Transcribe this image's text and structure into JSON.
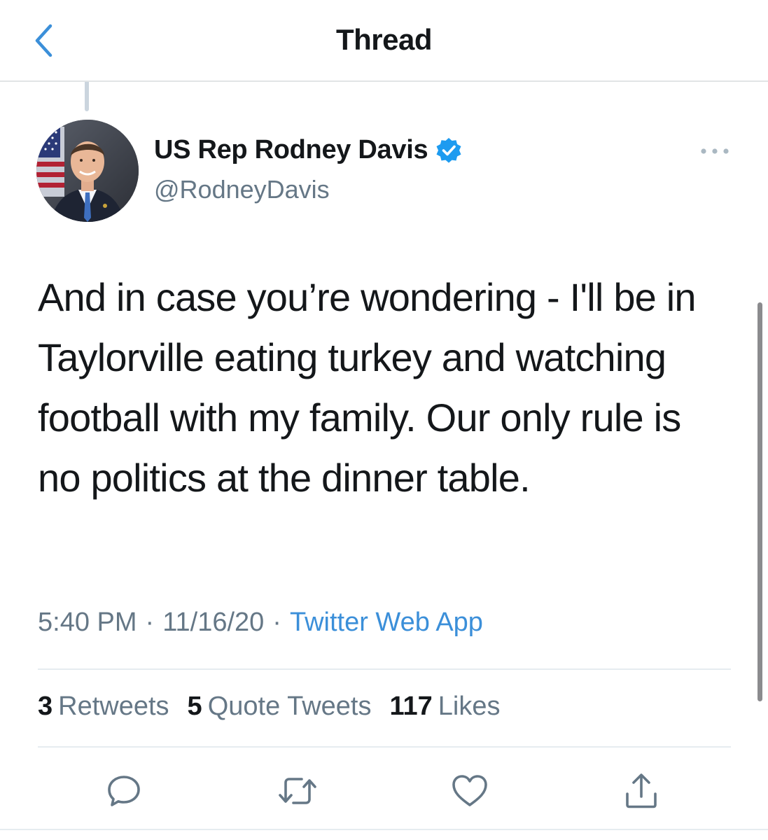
{
  "header": {
    "title": "Thread"
  },
  "author": {
    "name": "US Rep Rodney Davis",
    "handle": "@RodneyDavis"
  },
  "tweet": {
    "text": "And in case you’re wondering - I'll be in Taylorville eating turkey and watching football with my family. Our only rule is no politics at the dinner table.",
    "time": "5:40 PM",
    "date": "11/16/20",
    "separator": "·",
    "source": "Twitter Web App"
  },
  "stats": {
    "retweets_count": "3",
    "retweets_label": "Retweets",
    "quotes_count": "5",
    "quotes_label": "Quote Tweets",
    "likes_count": "117",
    "likes_label": "Likes"
  },
  "icons": {
    "back": "chevron-left-icon",
    "verified": "verified-badge-icon",
    "more": "more-horizontal-icon",
    "reply": "reply-icon",
    "retweet": "retweet-icon",
    "like": "heart-icon",
    "share": "share-icon"
  },
  "colors": {
    "accent": "#3b8fd9",
    "text": "#14171a",
    "secondary_text": "#657786",
    "verified": "#1d9bf0"
  }
}
